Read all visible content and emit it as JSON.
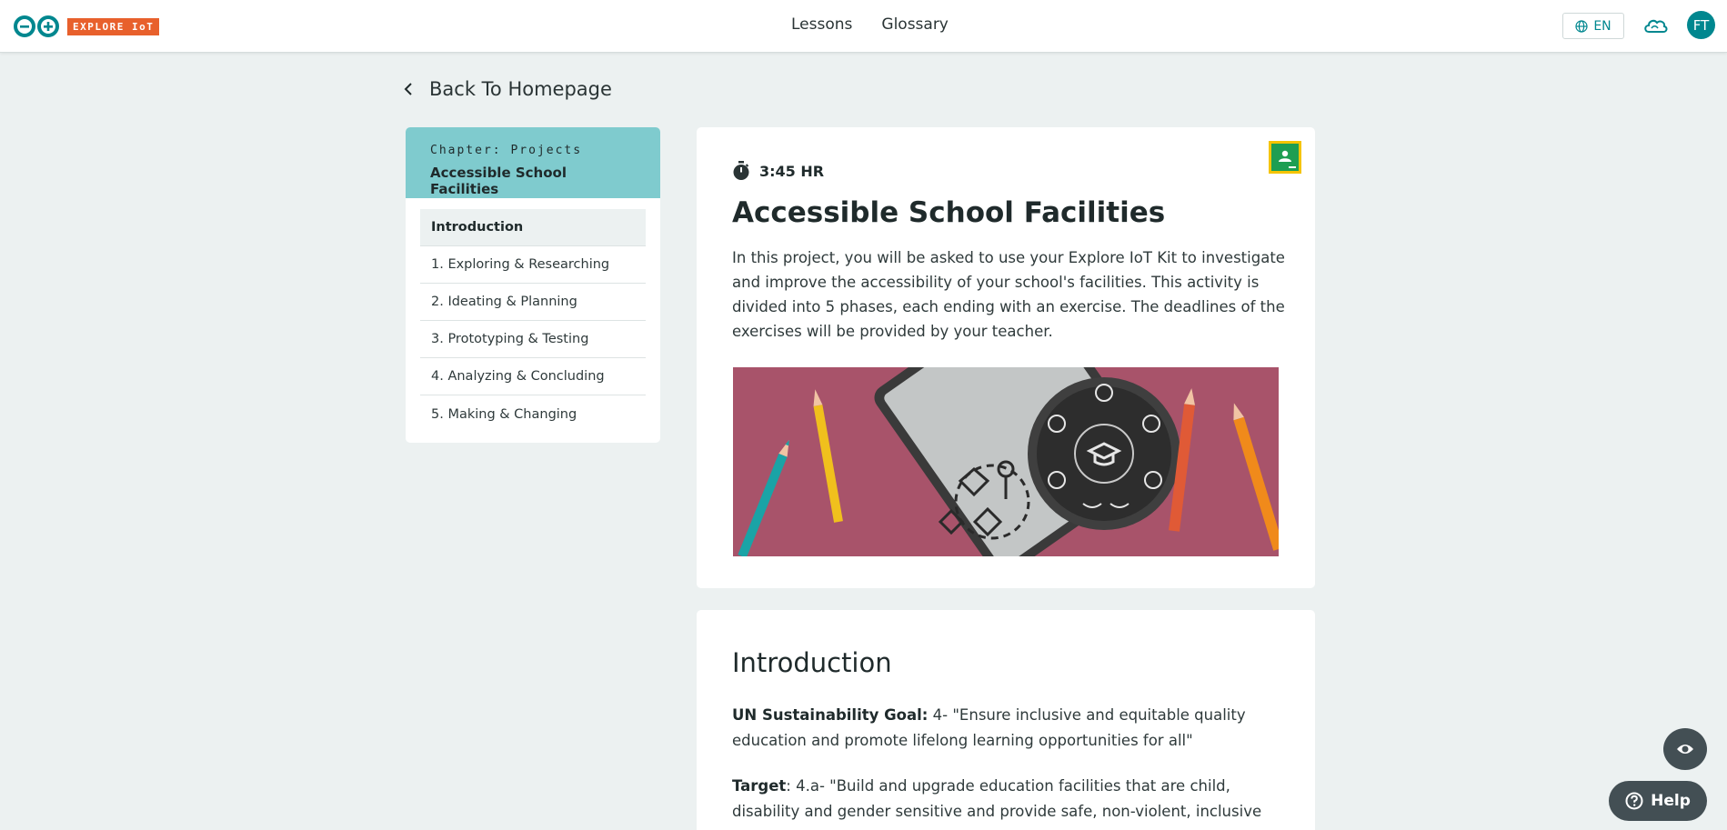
{
  "header": {
    "logo_text": "EXPLORE IoT",
    "nav": [
      "Lessons",
      "Glossary"
    ],
    "language": "EN",
    "avatar_initials": "FT"
  },
  "back_link": "Back To Homepage",
  "sidebar": {
    "chapter": "Chapter: Projects",
    "title": "Accessible School Facilities",
    "items": [
      {
        "label": "Introduction",
        "active": true
      },
      {
        "label": "1. Exploring & Researching",
        "active": false
      },
      {
        "label": "2. Ideating & Planning",
        "active": false
      },
      {
        "label": "3. Prototyping & Testing",
        "active": false
      },
      {
        "label": "4. Analyzing & Concluding",
        "active": false
      },
      {
        "label": "5. Making & Changing",
        "active": false
      }
    ]
  },
  "main": {
    "duration": "3:45 HR",
    "title": "Accessible School Facilities",
    "description": "In this project, you will be asked to use your Explore IoT Kit to investigate and improve the accessibility of your school's facilities. This activity is divided into 5 phases, each ending with an exercise. The deadlines of the exercises will be provided by your teacher."
  },
  "introduction": {
    "heading": "Introduction",
    "goal_label": "UN Sustainability Goal:",
    "goal_text": " 4- \"Ensure inclusive and equitable quality education and promote lifelong learning opportunities for all\"",
    "target_label": "Target",
    "target_text": ": 4.a- \"Build and upgrade education facilities that are child, disability and gender sensitive and provide safe, non-violent, inclusive and effective"
  },
  "floating": {
    "help_label": "Help"
  },
  "colors": {
    "accent": "#00878f",
    "sidebar_header": "#7fcbce",
    "logo_badge": "#e8602c",
    "hero_background": "#a8536a"
  }
}
